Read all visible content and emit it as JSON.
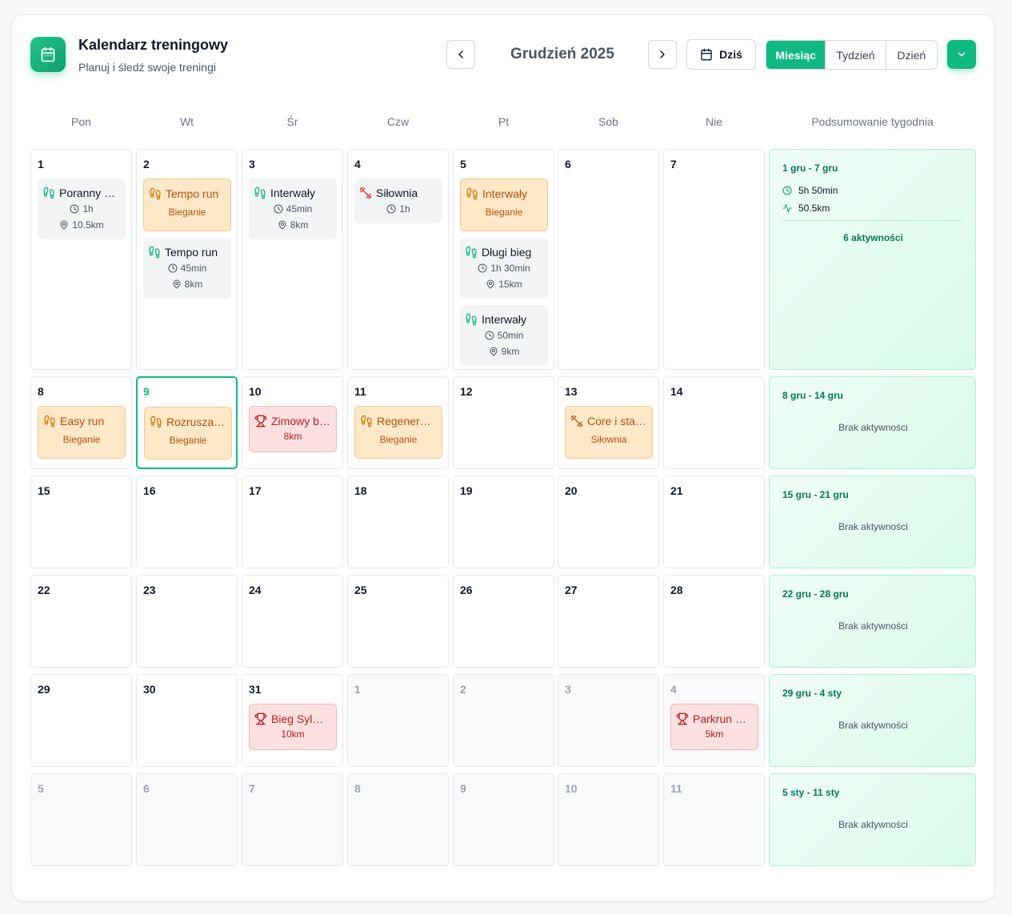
{
  "app": {
    "title": "Kalendarz treningowy",
    "subtitle": "Planuj i śledź swoje treningi",
    "icon": "calendar-icon",
    "accent": "#10b981"
  },
  "toolbar": {
    "prev_icon": "chevron-left-icon",
    "next_icon": "chevron-right-icon",
    "month": "Grudzień 2025",
    "today_label": "Dziś",
    "today_icon": "calendar-icon",
    "views": [
      "Miesiąc",
      "Tydzień",
      "Dzień"
    ],
    "active_view": "Miesiąc",
    "dropdown_icon": "chevron-down-icon"
  },
  "weekdays": [
    "Pon",
    "Wt",
    "Śr",
    "Czw",
    "Pt",
    "Sob",
    "Nie"
  ],
  "summary_header": "Podsumowanie tygodnia",
  "colors": {
    "run": "#10b981",
    "planned": "#b45309",
    "race": "#b91c1c",
    "gym": "#dc2626"
  },
  "weeks": [
    {
      "days": [
        {
          "n": "1",
          "events": [
            {
              "name": "Poranny bieg",
              "style": "gray",
              "icon": "footprints-icon",
              "lines": [
                {
                  "icon": "clock-icon",
                  "text": "1h"
                },
                {
                  "icon": "map-pin-icon",
                  "text": "10.5km"
                }
              ]
            }
          ]
        },
        {
          "n": "2",
          "events": [
            {
              "name": "Tempo run",
              "style": "orange",
              "icon": "footprints-icon",
              "sub": "Bieganie"
            },
            {
              "name": "Tempo run",
              "style": "gray",
              "icon": "footprints-icon",
              "lines": [
                {
                  "icon": "clock-icon",
                  "text": "45min"
                },
                {
                  "icon": "map-pin-icon",
                  "text": "8km"
                }
              ]
            }
          ]
        },
        {
          "n": "3",
          "events": [
            {
              "name": "Interwały",
              "style": "gray",
              "icon": "footprints-icon",
              "lines": [
                {
                  "icon": "clock-icon",
                  "text": "45min"
                },
                {
                  "icon": "map-pin-icon",
                  "text": "8km"
                }
              ]
            }
          ]
        },
        {
          "n": "4",
          "events": [
            {
              "name": "Siłownia",
              "style": "gray",
              "icon": "dumbbell-icon",
              "lines": [
                {
                  "icon": "clock-icon",
                  "text": "1h"
                }
              ]
            }
          ]
        },
        {
          "n": "5",
          "events": [
            {
              "name": "Interwały",
              "style": "orange",
              "icon": "footprints-icon",
              "sub": "Bieganie"
            },
            {
              "name": "Długi bieg",
              "style": "gray",
              "icon": "footprints-icon",
              "lines": [
                {
                  "icon": "clock-icon",
                  "text": "1h 30min"
                },
                {
                  "icon": "map-pin-icon",
                  "text": "15km"
                }
              ]
            },
            {
              "name": "Interwały",
              "style": "gray",
              "icon": "footprints-icon",
              "lines": [
                {
                  "icon": "clock-icon",
                  "text": "50min"
                },
                {
                  "icon": "map-pin-icon",
                  "text": "9km"
                }
              ]
            }
          ]
        },
        {
          "n": "6",
          "events": []
        },
        {
          "n": "7",
          "events": []
        }
      ],
      "summary": {
        "range": "1 gru - 7 gru",
        "time": "5h 50min",
        "distance": "50.5km",
        "count": "6 aktywności"
      }
    },
    {
      "days": [
        {
          "n": "8",
          "events": [
            {
              "name": "Easy run",
              "style": "orange",
              "icon": "footprints-icon",
              "sub": "Bieganie"
            }
          ]
        },
        {
          "n": "9",
          "today": true,
          "events": [
            {
              "name": "Rozruszanie",
              "style": "orange",
              "icon": "footprints-icon",
              "sub": "Bieganie"
            }
          ]
        },
        {
          "n": "10",
          "events": [
            {
              "name": "Zimowy bieg",
              "style": "red",
              "icon": "trophy-icon",
              "sub": "8km"
            }
          ]
        },
        {
          "n": "11",
          "events": [
            {
              "name": "Regeneracja",
              "style": "orange",
              "icon": "footprints-icon",
              "sub": "Bieganie"
            }
          ]
        },
        {
          "n": "12",
          "events": []
        },
        {
          "n": "13",
          "events": [
            {
              "name": "Core i stabilizacja",
              "style": "orange",
              "icon": "dumbbell-icon",
              "sub": "Siłownia"
            }
          ]
        },
        {
          "n": "14",
          "events": []
        }
      ],
      "summary": {
        "range": "8 gru - 14 gru",
        "empty": "Brak aktywności"
      }
    },
    {
      "days": [
        {
          "n": "15",
          "events": []
        },
        {
          "n": "16",
          "events": []
        },
        {
          "n": "17",
          "events": []
        },
        {
          "n": "18",
          "events": []
        },
        {
          "n": "19",
          "events": []
        },
        {
          "n": "20",
          "events": []
        },
        {
          "n": "21",
          "events": []
        }
      ],
      "summary": {
        "range": "15 gru - 21 gru",
        "empty": "Brak aktywności"
      }
    },
    {
      "days": [
        {
          "n": "22",
          "events": []
        },
        {
          "n": "23",
          "events": []
        },
        {
          "n": "24",
          "events": []
        },
        {
          "n": "25",
          "events": []
        },
        {
          "n": "26",
          "events": []
        },
        {
          "n": "27",
          "events": []
        },
        {
          "n": "28",
          "events": []
        }
      ],
      "summary": {
        "range": "22 gru - 28 gru",
        "empty": "Brak aktywności"
      }
    },
    {
      "days": [
        {
          "n": "29",
          "events": []
        },
        {
          "n": "30",
          "events": []
        },
        {
          "n": "31",
          "events": [
            {
              "name": "Bieg Sylwestrowy",
              "style": "red",
              "icon": "trophy-icon",
              "sub": "10km"
            }
          ]
        },
        {
          "n": "1",
          "muted": true,
          "events": []
        },
        {
          "n": "2",
          "muted": true,
          "events": []
        },
        {
          "n": "3",
          "muted": true,
          "events": []
        },
        {
          "n": "4",
          "muted": true,
          "events": [
            {
              "name": "Parkrun Nowy Rok",
              "style": "red",
              "icon": "trophy-icon",
              "sub": "5km"
            }
          ]
        }
      ],
      "summary": {
        "range": "29 gru - 4 sty",
        "empty": "Brak aktywności"
      }
    },
    {
      "days": [
        {
          "n": "5",
          "muted": true,
          "events": []
        },
        {
          "n": "6",
          "muted": true,
          "events": []
        },
        {
          "n": "7",
          "muted": true,
          "events": []
        },
        {
          "n": "8",
          "muted": true,
          "events": []
        },
        {
          "n": "9",
          "muted": true,
          "events": []
        },
        {
          "n": "10",
          "muted": true,
          "events": []
        },
        {
          "n": "11",
          "muted": true,
          "events": []
        }
      ],
      "summary": {
        "range": "5 sty - 11 sty",
        "empty": "Brak aktywności"
      }
    }
  ]
}
